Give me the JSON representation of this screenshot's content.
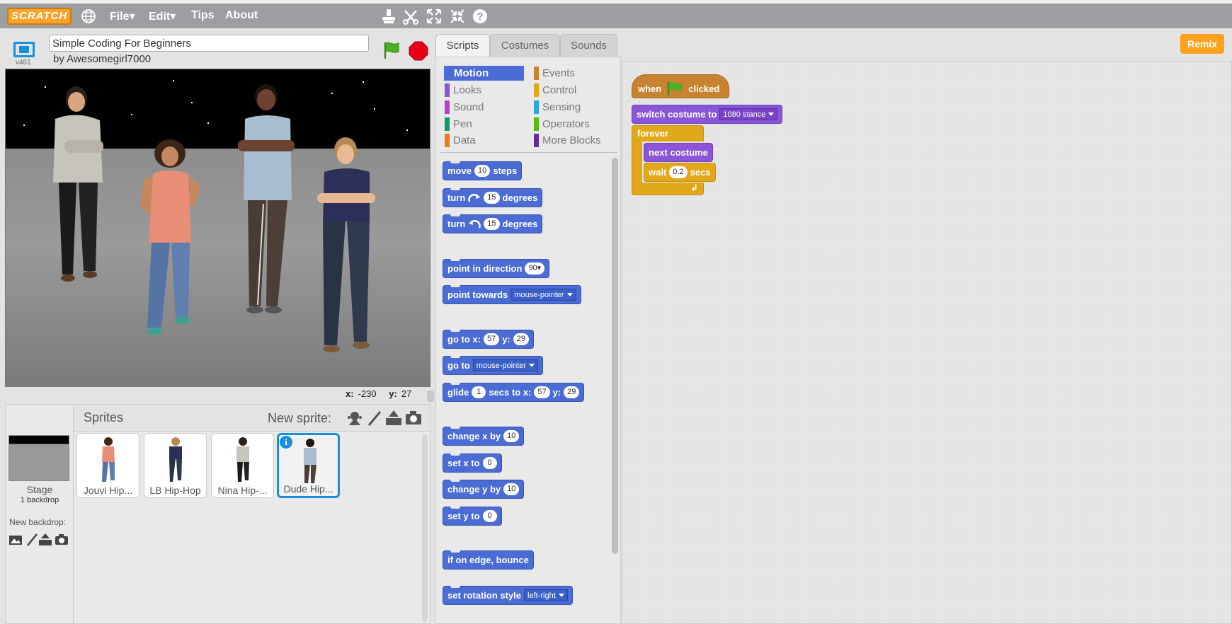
{
  "menubar": {
    "logo": "SCRATCH",
    "menus": [
      {
        "label": "File",
        "caret": "▾"
      },
      {
        "label": "Edit",
        "caret": "▾"
      },
      {
        "label": "Tips",
        "caret": ""
      },
      {
        "label": "About",
        "caret": ""
      }
    ],
    "icons": [
      "globe-icon",
      "duplicate-stamp-icon",
      "delete-scissors-icon",
      "grow-icon",
      "shrink-icon",
      "help-icon"
    ]
  },
  "project": {
    "title": "Simple Coding For Beginners",
    "byline": "by Awesomegirl7000",
    "version": "v461"
  },
  "stage": {
    "coords": {
      "x_label": "x:",
      "x": "-230",
      "y_label": "y:",
      "y": "27"
    }
  },
  "sprites": {
    "header_label": "Sprites",
    "new_sprite_label": "New sprite:",
    "stage_label": "Stage",
    "backdrop_count": "1 backdrop",
    "new_backdrop_label": "New backdrop:",
    "items": [
      {
        "name": "Jouvi Hip...",
        "selected": false
      },
      {
        "name": "LB Hip-Hop",
        "selected": false
      },
      {
        "name": "Nina Hip-...",
        "selected": false
      },
      {
        "name": "Dude Hip...",
        "selected": true
      }
    ],
    "info_badge": "i"
  },
  "tabs": [
    {
      "label": "Scripts",
      "active": true
    },
    {
      "label": "Costumes",
      "active": false
    },
    {
      "label": "Sounds",
      "active": false
    }
  ],
  "remix_label": "Remix",
  "categories": [
    {
      "label": "Motion",
      "color": "#4a6cd4",
      "active": true
    },
    {
      "label": "Looks",
      "color": "#8a55d7",
      "active": false
    },
    {
      "label": "Sound",
      "color": "#bb42c3",
      "active": false
    },
    {
      "label": "Pen",
      "color": "#0e9a6c",
      "active": false
    },
    {
      "label": "Data",
      "color": "#ee7d16",
      "active": false
    },
    {
      "label": "Events",
      "color": "#c88330",
      "active": false
    },
    {
      "label": "Control",
      "color": "#e1a91a",
      "active": false
    },
    {
      "label": "Sensing",
      "color": "#2ca5e2",
      "active": false
    },
    {
      "label": "Operators",
      "color": "#5cb712",
      "active": false
    },
    {
      "label": "More Blocks",
      "color": "#632d99",
      "active": false
    }
  ],
  "blocks": {
    "move": {
      "a": "move",
      "v": "10",
      "b": "steps"
    },
    "turn_right": {
      "a": "turn",
      "v": "15",
      "b": "degrees"
    },
    "turn_left": {
      "a": "turn",
      "v": "15",
      "b": "degrees"
    },
    "point_dir": {
      "a": "point in direction",
      "v": "90▾"
    },
    "point_towards": {
      "a": "point towards",
      "v": "mouse-pointer"
    },
    "goto_xy": {
      "a": "go to x:",
      "x": "57",
      "b": "y:",
      "y": "29"
    },
    "goto": {
      "a": "go to",
      "v": "mouse-pointer"
    },
    "glide": {
      "a": "glide",
      "s": "1",
      "b": "secs to x:",
      "x": "57",
      "c": "y:",
      "y": "29"
    },
    "change_x": {
      "a": "change x by",
      "v": "10"
    },
    "set_x": {
      "a": "set x to",
      "v": "0"
    },
    "change_y": {
      "a": "change y by",
      "v": "10"
    },
    "set_y": {
      "a": "set y to",
      "v": "0"
    },
    "bounce": {
      "a": "if on edge, bounce"
    },
    "rotation": {
      "a": "set rotation style",
      "v": "left-right"
    }
  },
  "script": {
    "hat": {
      "a": "when",
      "b": "clicked"
    },
    "switch_costume": {
      "a": "switch costume to",
      "v": "1080 stance"
    },
    "forever": "forever",
    "next_costume": "next costume",
    "wait": {
      "a": "wait",
      "v": "0.2",
      "b": "secs"
    },
    "loop_arrow": "↲"
  }
}
